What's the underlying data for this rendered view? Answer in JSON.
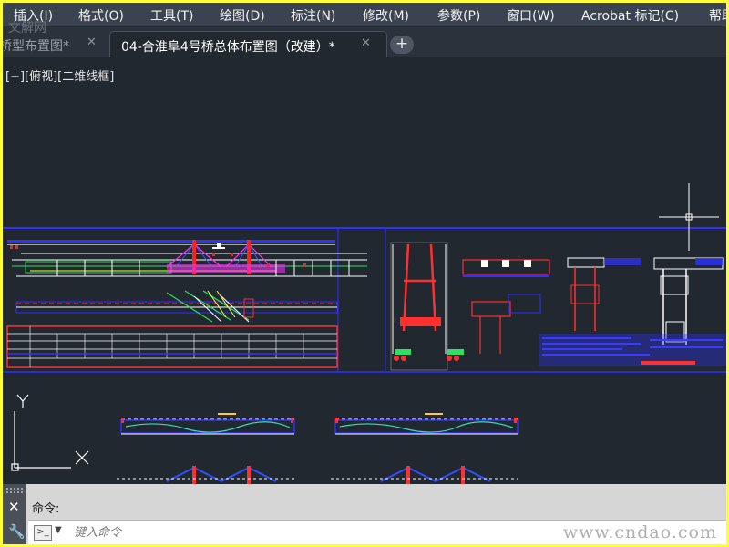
{
  "menubar": {
    "items": [
      {
        "label": "插入(I)"
      },
      {
        "label": "格式(O)"
      },
      {
        "label": "工具(T)"
      },
      {
        "label": "绘图(D)"
      },
      {
        "label": "标注(N)"
      },
      {
        "label": "修改(M)"
      },
      {
        "label": "参数(P)"
      },
      {
        "label": "窗口(W)"
      },
      {
        "label": "Acrobat 标记(C)"
      },
      {
        "label": "帮助"
      }
    ]
  },
  "watermark_top": "文解网",
  "tabs": [
    {
      "label": "桥型布置图*",
      "close": "✕",
      "active": false
    },
    {
      "label": "04-合淮阜4号桥总体布置图（改建）*",
      "close": "✕",
      "active": true
    }
  ],
  "tab_add": "+",
  "viewport": {
    "label": "[−][俯视][二维线框]"
  },
  "ucs": {
    "x_label": "X",
    "y_label": "Y"
  },
  "command": {
    "close_icon": "close-icon",
    "settings_icon": "wrench-icon",
    "history": "命令:",
    "prompt_icon": ">_",
    "placeholder": "键入命令"
  },
  "site_watermark": "www.cndao.com",
  "colors": {
    "canvas": "#212830",
    "border": "#ffff33",
    "frame_blue": "#1e1ee6"
  }
}
